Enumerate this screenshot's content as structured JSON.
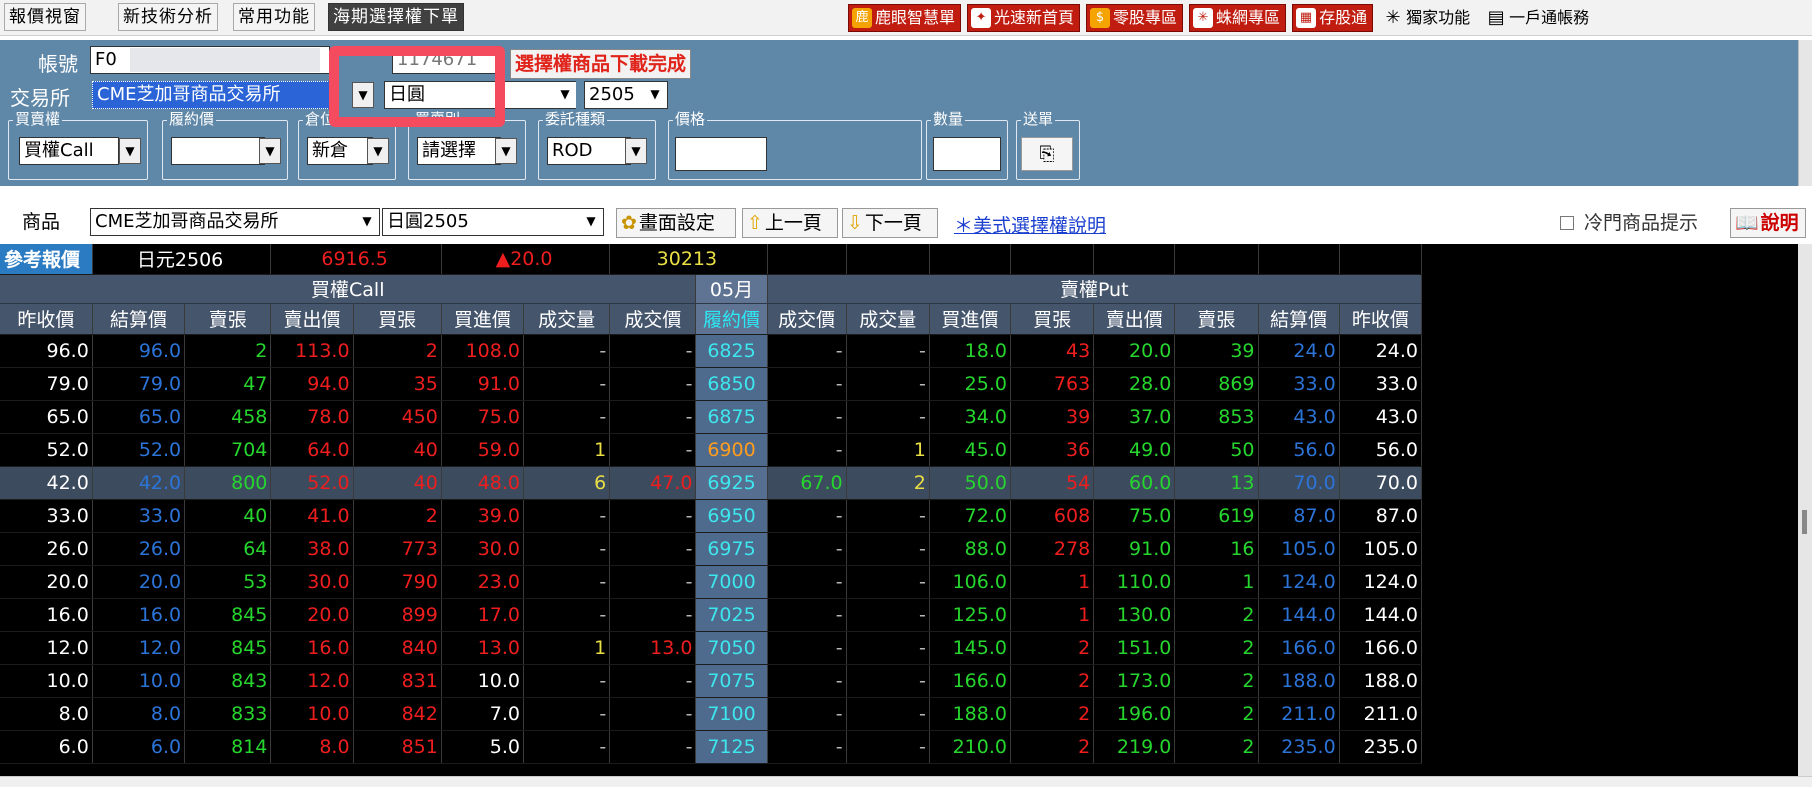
{
  "menu": {
    "tabs": [
      "報價視窗",
      "新技術分析",
      "常用功能",
      "海期選擇權下單"
    ]
  },
  "quick_links": [
    {
      "label": "鹿眼智慧單",
      "icon": "deer-icon"
    },
    {
      "label": "光速新首頁",
      "icon": "star-icon"
    },
    {
      "label": "零股專區",
      "icon": "coin-icon"
    },
    {
      "label": "蛛網專區",
      "icon": "web-icon"
    },
    {
      "label": "存股通",
      "icon": "calculator-icon"
    },
    {
      "label": "獨家功能",
      "icon": "sparkle-icon"
    },
    {
      "label": "一戶通帳務",
      "icon": "document-icon"
    }
  ],
  "order": {
    "account_label": "帳號",
    "account_value": "F0",
    "account_second": "1174671",
    "status": "選擇權商品下載完成",
    "exchange_label": "交易所",
    "exchange_value": "CME芝加哥商品交易所",
    "product_value": "日圓",
    "month_value": "2505",
    "groups": {
      "side": {
        "label": "買賣權",
        "value": "買權Call"
      },
      "strike": {
        "label": "履約價",
        "value": ""
      },
      "position": {
        "label": "倉位",
        "value": "新倉"
      },
      "bs": {
        "label": "買賣別",
        "value": "請選擇"
      },
      "tif": {
        "label": "委託種類",
        "value": "ROD"
      },
      "price": {
        "label": "價格",
        "value": ""
      },
      "qty": {
        "label": "數量",
        "value": ""
      },
      "send": {
        "label": "送單"
      }
    }
  },
  "productbar": {
    "label": "商品",
    "exchange": "CME芝加哥商品交易所",
    "product": "日圓2505",
    "screen_settings": "畫面設定",
    "prev_page": "上一頁",
    "next_page": "下一頁",
    "help_link": "＊美式選擇權說明",
    "cold_hint": "冷門商品提示",
    "explain": "說明"
  },
  "reference": {
    "label": "參考報價",
    "name": "日元2506",
    "price": "6916.5",
    "change": "▲20.0",
    "volume": "30213"
  },
  "table": {
    "call_title": "買權Call",
    "month": "05月",
    "put_title": "賣權Put",
    "call_headers": [
      "昨收價",
      "結算價",
      "賣張",
      "賣出價",
      "買張",
      "買進價",
      "成交量",
      "成交價"
    ],
    "strike_header": "履約價",
    "put_headers": [
      "成交價",
      "成交量",
      "買進價",
      "買張",
      "賣出價",
      "賣張",
      "結算價",
      "昨收價"
    ],
    "rows": [
      {
        "call": [
          "96.0",
          "96.0",
          "2",
          "113.0",
          "2",
          "108.0",
          "-",
          "-"
        ],
        "strike": "6825",
        "put": [
          "-",
          "-",
          "18.0",
          "43",
          "20.0",
          "39",
          "24.0",
          "24.0"
        ]
      },
      {
        "call": [
          "79.0",
          "79.0",
          "47",
          "94.0",
          "35",
          "91.0",
          "-",
          "-"
        ],
        "strike": "6850",
        "put": [
          "-",
          "-",
          "25.0",
          "763",
          "28.0",
          "869",
          "33.0",
          "33.0"
        ]
      },
      {
        "call": [
          "65.0",
          "65.0",
          "458",
          "78.0",
          "450",
          "75.0",
          "-",
          "-"
        ],
        "strike": "6875",
        "put": [
          "-",
          "-",
          "34.0",
          "39",
          "37.0",
          "853",
          "43.0",
          "43.0"
        ]
      },
      {
        "call": [
          "52.0",
          "52.0",
          "704",
          "64.0",
          "40",
          "59.0",
          "1",
          "-"
        ],
        "strike": "6900",
        "put": [
          "-",
          "1",
          "45.0",
          "36",
          "49.0",
          "50",
          "56.0",
          "56.0"
        ]
      },
      {
        "call": [
          "42.0",
          "42.0",
          "800",
          "52.0",
          "40",
          "48.0",
          "6",
          "47.0"
        ],
        "strike": "6925",
        "put": [
          "67.0",
          "2",
          "50.0",
          "54",
          "60.0",
          "13",
          "70.0",
          "70.0"
        ]
      },
      {
        "call": [
          "33.0",
          "33.0",
          "40",
          "41.0",
          "2",
          "39.0",
          "-",
          "-"
        ],
        "strike": "6950",
        "put": [
          "-",
          "-",
          "72.0",
          "608",
          "75.0",
          "619",
          "87.0",
          "87.0"
        ]
      },
      {
        "call": [
          "26.0",
          "26.0",
          "64",
          "38.0",
          "773",
          "30.0",
          "-",
          "-"
        ],
        "strike": "6975",
        "put": [
          "-",
          "-",
          "88.0",
          "278",
          "91.0",
          "16",
          "105.0",
          "105.0"
        ]
      },
      {
        "call": [
          "20.0",
          "20.0",
          "53",
          "30.0",
          "790",
          "23.0",
          "-",
          "-"
        ],
        "strike": "7000",
        "put": [
          "-",
          "-",
          "106.0",
          "1",
          "110.0",
          "1",
          "124.0",
          "124.0"
        ]
      },
      {
        "call": [
          "16.0",
          "16.0",
          "845",
          "20.0",
          "899",
          "17.0",
          "-",
          "-"
        ],
        "strike": "7025",
        "put": [
          "-",
          "-",
          "125.0",
          "1",
          "130.0",
          "2",
          "144.0",
          "144.0"
        ]
      },
      {
        "call": [
          "12.0",
          "12.0",
          "845",
          "16.0",
          "840",
          "13.0",
          "1",
          "13.0"
        ],
        "strike": "7050",
        "put": [
          "-",
          "-",
          "145.0",
          "2",
          "151.0",
          "2",
          "166.0",
          "166.0"
        ]
      },
      {
        "call": [
          "10.0",
          "10.0",
          "843",
          "12.0",
          "831",
          "10.0",
          "-",
          "-"
        ],
        "strike": "7075",
        "put": [
          "-",
          "-",
          "166.0",
          "2",
          "173.0",
          "2",
          "188.0",
          "188.0"
        ]
      },
      {
        "call": [
          "8.0",
          "8.0",
          "833",
          "10.0",
          "842",
          "7.0",
          "-",
          "-"
        ],
        "strike": "7100",
        "put": [
          "-",
          "-",
          "188.0",
          "2",
          "196.0",
          "2",
          "211.0",
          "211.0"
        ]
      },
      {
        "call": [
          "6.0",
          "6.0",
          "814",
          "8.0",
          "851",
          "5.0",
          "-",
          "-"
        ],
        "strike": "7125",
        "put": [
          "-",
          "-",
          "210.0",
          "2",
          "219.0",
          "2",
          "235.0",
          "235.0"
        ]
      }
    ]
  },
  "colors": {
    "panel": "#5f87a7",
    "header": "#45556c",
    "strike_bg": "#4e6a8c",
    "strike_text": "#3ee6ee",
    "up_red": "#ee1e1e",
    "green": "#26d62e",
    "blue": "#2c74d8",
    "yellow": "#eadf44",
    "orange": "#ff9d1e"
  }
}
